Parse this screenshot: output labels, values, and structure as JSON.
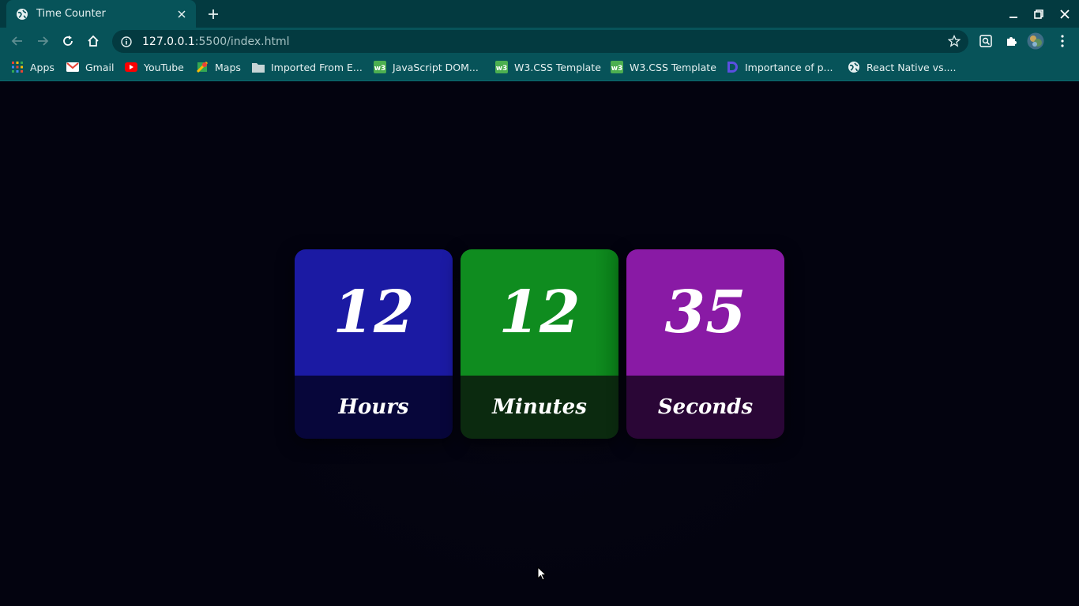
{
  "browser": {
    "tab": {
      "title": "Time Counter"
    },
    "url": {
      "host": "127.0.0.1",
      "path": ":5500/index.html"
    },
    "bookmarks": [
      {
        "label": "Apps",
        "icon": "apps-grid-icon"
      },
      {
        "label": "Gmail",
        "icon": "gmail-icon"
      },
      {
        "label": "YouTube",
        "icon": "youtube-icon"
      },
      {
        "label": "Maps",
        "icon": "maps-icon"
      },
      {
        "label": "Imported From E...",
        "icon": "folder-icon"
      },
      {
        "label": "JavaScript DOM...",
        "icon": "w3schools-icon"
      },
      {
        "label": "W3.CSS Template",
        "icon": "w3schools-icon"
      },
      {
        "label": "W3.CSS Template",
        "icon": "w3schools-icon"
      },
      {
        "label": "Importance of p...",
        "icon": "dev-icon"
      },
      {
        "label": "React Native vs....",
        "icon": "globe-icon"
      }
    ]
  },
  "counter": {
    "hours": {
      "value": "12",
      "label": "Hours",
      "color": "#1b1aa3",
      "label_bg": "#07063a"
    },
    "minutes": {
      "value": "12",
      "label": "Minutes",
      "color": "#0f8c1f",
      "label_bg": "#0b2a0f"
    },
    "seconds": {
      "value": "35",
      "label": "Seconds",
      "color": "#891aa5",
      "label_bg": "#2a0636"
    }
  },
  "theme": {
    "chrome_dark": "#033a40",
    "chrome": "#075359",
    "page_bg": "#03030f"
  }
}
